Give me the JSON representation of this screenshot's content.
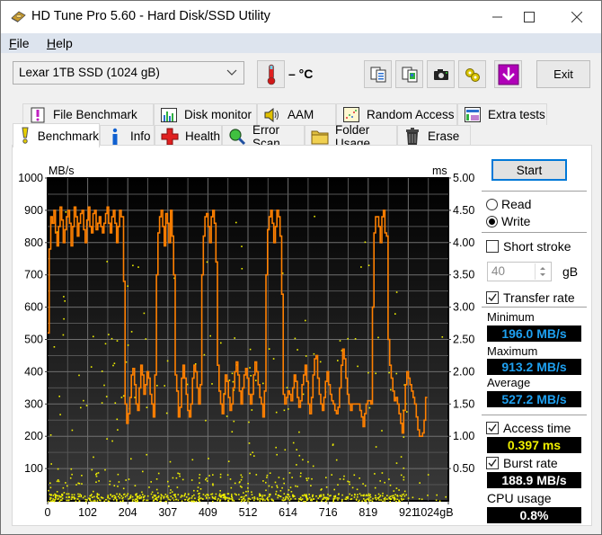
{
  "window": {
    "title": "HD Tune Pro 5.60 - Hard Disk/SSD Utility",
    "app_icon": "hard-disk-icon",
    "controls": [
      "minimize",
      "maximize",
      "close"
    ]
  },
  "menu": [
    {
      "label": "File",
      "accel": "F",
      "rest": "ile"
    },
    {
      "label": "Help",
      "accel": "H",
      "rest": "elp"
    }
  ],
  "toolbar": {
    "drive": "Lexar 1TB SSD (1024 gB)",
    "temperature": "– °C",
    "buttons": [
      {
        "name": "copy-text-icon"
      },
      {
        "name": "copy-image-icon"
      },
      {
        "name": "screenshot-camera-icon"
      },
      {
        "name": "options-icon"
      },
      {
        "name": "save-download-icon"
      }
    ],
    "exit_label": "Exit"
  },
  "tabs": {
    "top_row": [
      {
        "label": "File Benchmark",
        "icon": "file-benchmark-icon"
      },
      {
        "label": "Disk monitor",
        "icon": "disk-monitor-icon"
      },
      {
        "label": "AAM",
        "icon": "speaker-icon"
      },
      {
        "label": "Random Access",
        "icon": "random-access-icon"
      },
      {
        "label": "Extra tests",
        "icon": "extra-tests-icon"
      }
    ],
    "bottom_row": [
      {
        "label": "Benchmark",
        "icon": "exclamation-icon",
        "active": true
      },
      {
        "label": "Info",
        "icon": "info-icon"
      },
      {
        "label": "Health",
        "icon": "health-cross-icon"
      },
      {
        "label": "Error Scan",
        "icon": "magnifier-icon"
      },
      {
        "label": "Folder Usage",
        "icon": "folder-icon"
      },
      {
        "label": "Erase",
        "icon": "trash-icon"
      }
    ]
  },
  "side_panel": {
    "start_label": "Start",
    "mode": {
      "read_label": "Read",
      "write_label": "Write",
      "selected": "Write"
    },
    "short_stroke": {
      "label": "Short stroke",
      "checked": false,
      "value": "40",
      "unit": "gB"
    },
    "transfer_rate": {
      "label": "Transfer rate",
      "checked": true
    },
    "minimum": {
      "label": "Minimum",
      "value": "196.0 MB/s"
    },
    "maximum": {
      "label": "Maximum",
      "value": "913.2 MB/s"
    },
    "average": {
      "label": "Average",
      "value": "527.2 MB/s"
    },
    "access_time": {
      "label": "Access time",
      "checked": true,
      "value": "0.397 ms"
    },
    "burst_rate": {
      "label": "Burst rate",
      "checked": true,
      "value": "188.9 MB/s"
    },
    "cpu_usage": {
      "label": "CPU usage",
      "value": "0.8%"
    }
  },
  "colors": {
    "transfer_line": "#ff8000",
    "access_points": "#f0f000",
    "stat_blue": "#1ea0f0",
    "focus_blue": "#0078d7"
  },
  "chart_data": {
    "type": "line",
    "title": "",
    "xlabel": "gB",
    "ylabel": "MB/s",
    "y2label": "ms",
    "xlim": [
      0,
      1024
    ],
    "ylim": [
      0,
      1000
    ],
    "y2lim": [
      0,
      5
    ],
    "grid": true,
    "x_ticks": [
      "0",
      "102",
      "204",
      "307",
      "409",
      "512",
      "614",
      "716",
      "819",
      "921",
      "1024gB"
    ],
    "y_ticks": [
      "1000",
      "900",
      "800",
      "700",
      "600",
      "500",
      "400",
      "300",
      "200",
      "100"
    ],
    "y2_ticks": [
      "5.00",
      "4.50",
      "4.00",
      "3.50",
      "3.00",
      "2.50",
      "2.00",
      "1.50",
      "1.00",
      "0.50"
    ],
    "series": [
      {
        "name": "Transfer rate (MB/s)",
        "x": [
          0,
          4,
          8,
          12,
          16,
          20,
          24,
          28,
          32,
          36,
          40,
          44,
          48,
          52,
          56,
          60,
          64,
          68,
          72,
          76,
          80,
          84,
          88,
          92,
          96,
          100,
          104,
          108,
          112,
          116,
          120,
          124,
          128,
          132,
          136,
          140,
          144,
          148,
          152,
          156,
          160,
          164,
          168,
          172,
          176,
          180,
          184,
          188,
          190,
          194,
          198,
          202,
          206,
          210,
          214,
          218,
          222,
          226,
          230,
          234,
          238,
          242,
          246,
          250,
          254,
          258,
          262,
          266,
          270,
          274,
          278,
          282,
          286,
          290,
          294,
          298,
          302,
          306,
          310,
          314,
          318,
          322,
          326,
          330,
          334,
          338,
          342,
          346,
          350,
          354,
          358,
          362,
          366,
          370,
          374,
          378,
          382,
          386,
          390,
          394,
          398,
          402,
          406,
          410,
          414,
          418,
          422,
          426,
          430,
          434,
          438,
          442,
          446,
          450,
          454,
          458,
          462,
          466,
          470,
          474,
          478,
          482,
          486,
          490,
          494,
          498,
          502,
          506,
          510,
          514,
          518,
          522,
          526,
          530,
          534,
          538,
          542,
          546,
          550,
          554,
          558,
          562,
          566,
          570,
          574,
          578,
          582,
          586,
          590,
          594,
          598,
          602,
          606,
          610,
          614,
          618,
          622,
          626,
          630,
          634,
          638,
          642,
          646,
          650,
          654,
          658,
          662,
          666,
          670,
          674,
          678,
          682,
          686,
          690,
          694,
          698,
          702,
          706,
          710,
          714,
          718,
          722,
          726,
          730,
          734,
          738,
          742,
          746,
          750,
          754,
          758,
          762,
          766,
          770,
          774,
          778,
          782,
          786,
          790,
          794,
          798,
          802,
          806,
          810,
          814,
          818,
          822,
          826,
          830,
          834,
          838,
          842,
          846,
          850,
          854,
          858,
          862,
          866,
          870,
          874,
          878,
          882,
          886,
          890,
          894,
          898,
          902,
          906,
          910,
          914,
          918,
          922,
          926,
          930,
          934,
          938,
          942,
          946,
          950,
          954,
          958,
          962,
          966,
          970,
          974,
          978,
          982,
          986,
          990,
          994,
          998,
          1002,
          1006,
          1010,
          1014,
          1018,
          1024
        ],
        "values": [
          520,
          780,
          880,
          860,
          900,
          830,
          790,
          850,
          910,
          870,
          800,
          840,
          880,
          900,
          860,
          790,
          850,
          910,
          880,
          820,
          860,
          890,
          900,
          840,
          800,
          870,
          910,
          850,
          830,
          890,
          900,
          840,
          860,
          880,
          850,
          830,
          860,
          890,
          910,
          860,
          830,
          880,
          900,
          860,
          800,
          850,
          900,
          880,
          880,
          680,
          300,
          240,
          270,
          320,
          390,
          410,
          360,
          300,
          280,
          350,
          420,
          390,
          330,
          360,
          400,
          380,
          330,
          300,
          260,
          390,
          700,
          830,
          880,
          900,
          850,
          790,
          890,
          860,
          800,
          900,
          820,
          700,
          390,
          340,
          260,
          290,
          380,
          420,
          380,
          330,
          280,
          260,
          300,
          380,
          420,
          400,
          350,
          300,
          360,
          700,
          820,
          880,
          890,
          850,
          800,
          880,
          900,
          860,
          740,
          420,
          340,
          300,
          270,
          330,
          390,
          370,
          320,
          280,
          300,
          350,
          400,
          430,
          390,
          340,
          300,
          350,
          390,
          410,
          380,
          330,
          300,
          330,
          390,
          430,
          400,
          360,
          320,
          300,
          260,
          340,
          700,
          840,
          880,
          900,
          860,
          800,
          850,
          900,
          880,
          820,
          640,
          330,
          300,
          320,
          340,
          330,
          310,
          350,
          390,
          370,
          320,
          290,
          310,
          360,
          390,
          420,
          370,
          300,
          270,
          320,
          390,
          440,
          450,
          380,
          330,
          300,
          280,
          320,
          370,
          400,
          360,
          330,
          310,
          300,
          280,
          270,
          290,
          350,
          420,
          470,
          440,
          380,
          330,
          300,
          280,
          300,
          300,
          300,
          300,
          300,
          280,
          260,
          230,
          270,
          300,
          310,
          310,
          300,
          600,
          830,
          880,
          880,
          850,
          800,
          880,
          900,
          830,
          820,
          500,
          420,
          380,
          340,
          310,
          320,
          300,
          270,
          240,
          210,
          280,
          360,
          400,
          380,
          360,
          340,
          320,
          300,
          260,
          220,
          200,
          200,
          210,
          250,
          320
        ]
      },
      {
        "name": "Access time (ms)",
        "type": "scatter",
        "description": "Dense yellow dots mostly between 0.0 and 0.3 ms, sparser scatter up to ~2.5 ms, a few outliers near 4.2–4.6 ms"
      }
    ]
  }
}
